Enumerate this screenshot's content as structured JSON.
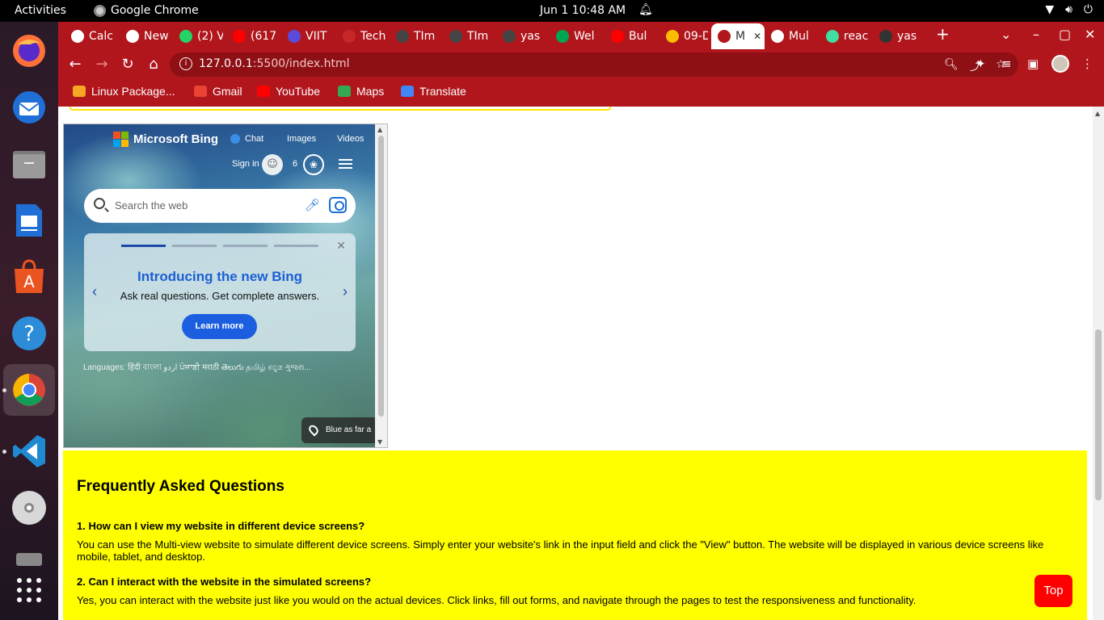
{
  "system": {
    "activities": "Activities",
    "app_name": "Google Chrome",
    "clock": "Jun 1  10:48 AM"
  },
  "dock": {
    "apps": [
      "firefox-icon",
      "thunderbird-icon",
      "files-icon",
      "libreoffice-impress-icon",
      "app-center-icon",
      "help-icon",
      "chrome-icon",
      "vscode-icon",
      "dvd-icon",
      "trash-icon",
      "show-apps-icon"
    ]
  },
  "tabs": [
    {
      "label": "Calc",
      "color": "#ffffff"
    },
    {
      "label": "New",
      "color": "#ffffff"
    },
    {
      "label": "(2) V",
      "color": "#25d366"
    },
    {
      "label": "(617",
      "color": "#ff0000"
    },
    {
      "label": "VIIT",
      "color": "#5b4bdb"
    },
    {
      "label": "Tech",
      "color": "#c62828"
    },
    {
      "label": "TIm",
      "color": "#444444"
    },
    {
      "label": "TIm",
      "color": "#444444"
    },
    {
      "label": "yas",
      "color": "#444444"
    },
    {
      "label": "Wel",
      "color": "#00a651"
    },
    {
      "label": "Bul",
      "color": "#ff0000"
    },
    {
      "label": "09-D",
      "color": "#fbbc04"
    },
    {
      "label": "M",
      "color": "#b0161c",
      "active": true
    },
    {
      "label": "Mul",
      "color": "#ffffff"
    },
    {
      "label": "reac",
      "color": "#40e0a0"
    },
    {
      "label": "yas",
      "color": "#333333"
    }
  ],
  "omnibox": {
    "host": "127.0.0.1",
    "rest": ":5500/index.html"
  },
  "bookmarks": [
    {
      "label": "Linux Package...",
      "color": "#f5a623"
    },
    {
      "label": "Gmail",
      "color": "#ea4335"
    },
    {
      "label": "YouTube",
      "color": "#ff0000"
    },
    {
      "label": "Maps",
      "color": "#34a853"
    },
    {
      "label": "Translate",
      "color": "#4285f4"
    }
  ],
  "bing": {
    "logo_text": "Microsoft Bing",
    "nav": [
      "Chat",
      "Images",
      "Videos"
    ],
    "sign_in": "Sign in",
    "rewards_count": "6",
    "search_placeholder": "Search the web",
    "promo_title": "Introducing the new Bing",
    "promo_sub": "Ask real questions. Get complete answers.",
    "learn_more": "Learn more",
    "languages": "Languages:  हिंदी  বাংলা  اردو  ਪੰਜਾਬੀ  मराठी  తెలుగు  தமிழ்  ಕನ್ನಡ  ગુજરા...",
    "caption": "Blue as far a"
  },
  "faq": {
    "heading": "Frequently Asked Questions",
    "items": [
      {
        "q": "1. How can I view my website in different device screens?",
        "a": "You can use the Multi-view website to simulate different device screens. Simply enter your website's link in the input field and click the \"View\" button. The website will be displayed in various device screens like mobile, tablet, and desktop."
      },
      {
        "q": "2. Can I interact with the website in the simulated screens?",
        "a": "Yes, you can interact with the website just like you would on the actual devices. Click links, fill out forms, and navigate through the pages to test the responsiveness and functionality."
      }
    ]
  },
  "top_button": "Top",
  "colors": {
    "chrome_theme": "#b0161c",
    "faq_bg": "#ffff00",
    "top_button": "#ff0000",
    "bing_blue": "#1b5fe0"
  }
}
